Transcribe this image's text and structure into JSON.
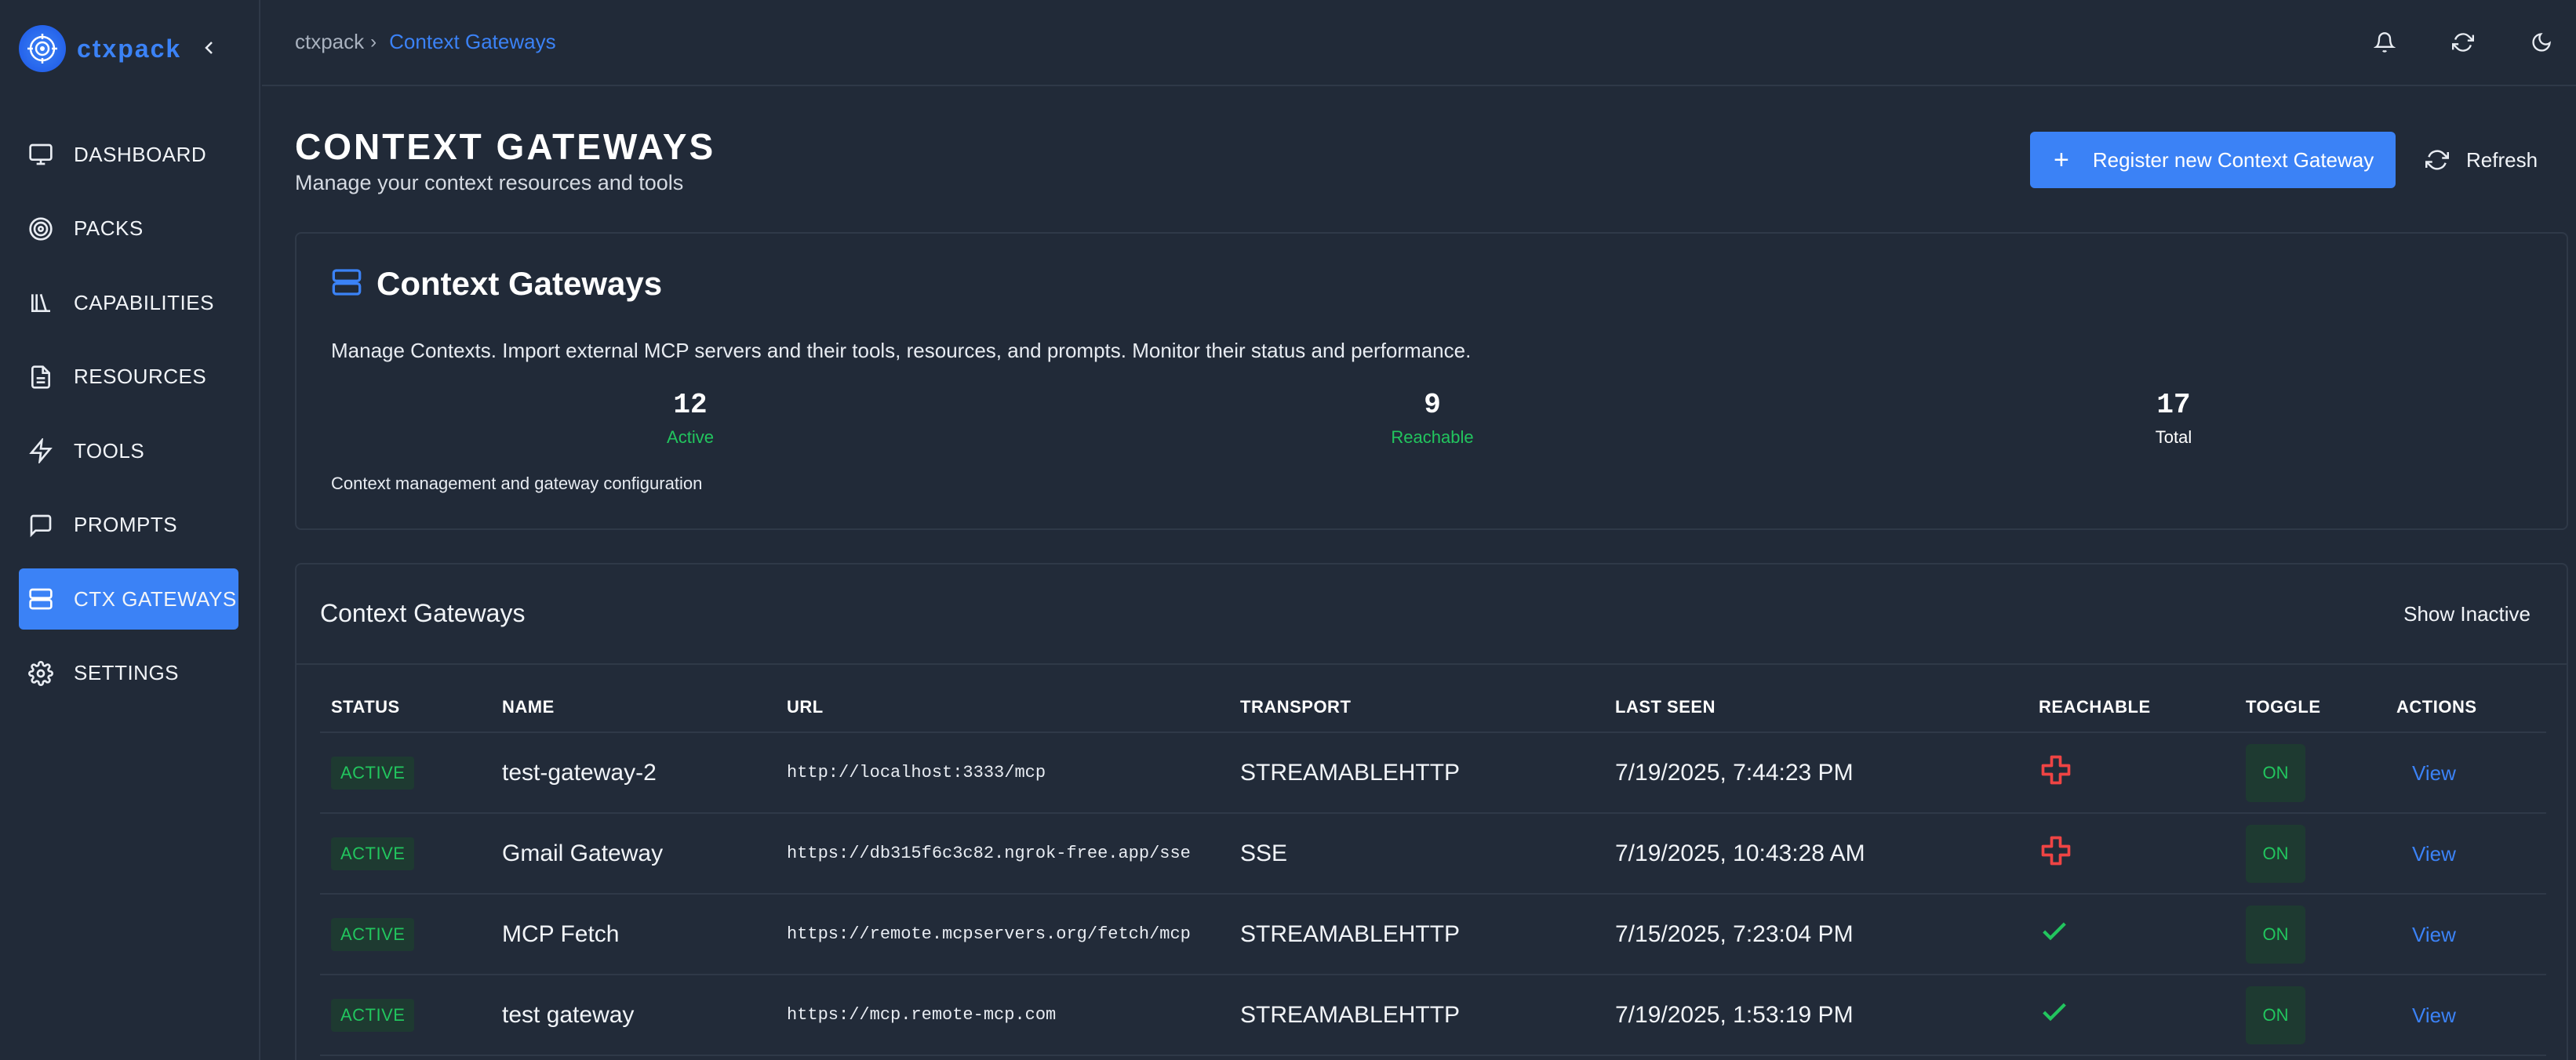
{
  "app": {
    "name": "ctxpack"
  },
  "sidebar": {
    "items": [
      {
        "label": "DASHBOARD",
        "icon": "monitor-icon",
        "active": false
      },
      {
        "label": "PACKS",
        "icon": "target-icon",
        "active": false
      },
      {
        "label": "CAPABILITIES",
        "icon": "library-icon",
        "active": false
      },
      {
        "label": "RESOURCES",
        "icon": "document-icon",
        "active": false
      },
      {
        "label": "TOOLS",
        "icon": "bolt-icon",
        "active": false
      },
      {
        "label": "PROMPTS",
        "icon": "chat-icon",
        "active": false
      },
      {
        "label": "CTX GATEWAYS",
        "icon": "server-icon",
        "active": true
      },
      {
        "label": "SETTINGS",
        "icon": "gear-icon",
        "active": false
      }
    ]
  },
  "breadcrumb": {
    "root": "ctxpack",
    "separator": "›",
    "current": "Context Gateways"
  },
  "header": {
    "title": "CONTEXT GATEWAYS",
    "subtitle": "Manage your context resources and tools",
    "register_label": "Register new Context Gateway",
    "refresh_label": "Refresh"
  },
  "summary": {
    "title": "Context Gateways",
    "description": "Manage Contexts. Import external MCP servers and their tools, resources, and prompts. Monitor their status and performance.",
    "stats": [
      {
        "value": "12",
        "label": "Active",
        "color": "#22c55e"
      },
      {
        "value": "9",
        "label": "Reachable",
        "color": "#22c55e"
      },
      {
        "value": "17",
        "label": "Total",
        "color": "#ffffff"
      }
    ],
    "footer": "Context management and gateway configuration"
  },
  "table": {
    "title": "Context Gateways",
    "show_inactive_label": "Show Inactive",
    "columns": [
      "STATUS",
      "NAME",
      "URL",
      "TRANSPORT",
      "LAST SEEN",
      "REACHABLE",
      "TOGGLE",
      "ACTIONS"
    ],
    "rows": [
      {
        "status": "ACTIVE",
        "name": "test-gateway-2",
        "url": "http://localhost:3333/mcp",
        "transport": "STREAMABLEHTTP",
        "last_seen": "7/19/2025, 7:44:23 PM",
        "reachable": false,
        "toggle": "ON",
        "action": "View"
      },
      {
        "status": "ACTIVE",
        "name": "Gmail Gateway",
        "url": "https://db315f6c3c82.ngrok-free.app/sse",
        "transport": "SSE",
        "last_seen": "7/19/2025, 10:43:28 AM",
        "reachable": false,
        "toggle": "ON",
        "action": "View"
      },
      {
        "status": "ACTIVE",
        "name": "MCP Fetch",
        "url": "https://remote.mcpservers.org/fetch/mcp",
        "transport": "STREAMABLEHTTP",
        "last_seen": "7/15/2025, 7:23:04 PM",
        "reachable": true,
        "toggle": "ON",
        "action": "View"
      },
      {
        "status": "ACTIVE",
        "name": "test gateway",
        "url": "https://mcp.remote-mcp.com",
        "transport": "STREAMABLEHTTP",
        "last_seen": "7/19/2025, 1:53:19 PM",
        "reachable": true,
        "toggle": "ON",
        "action": "View"
      }
    ]
  },
  "colors": {
    "accent": "#3b82f6",
    "success": "#22c55e",
    "danger": "#ef4444",
    "background": "#212a38"
  }
}
